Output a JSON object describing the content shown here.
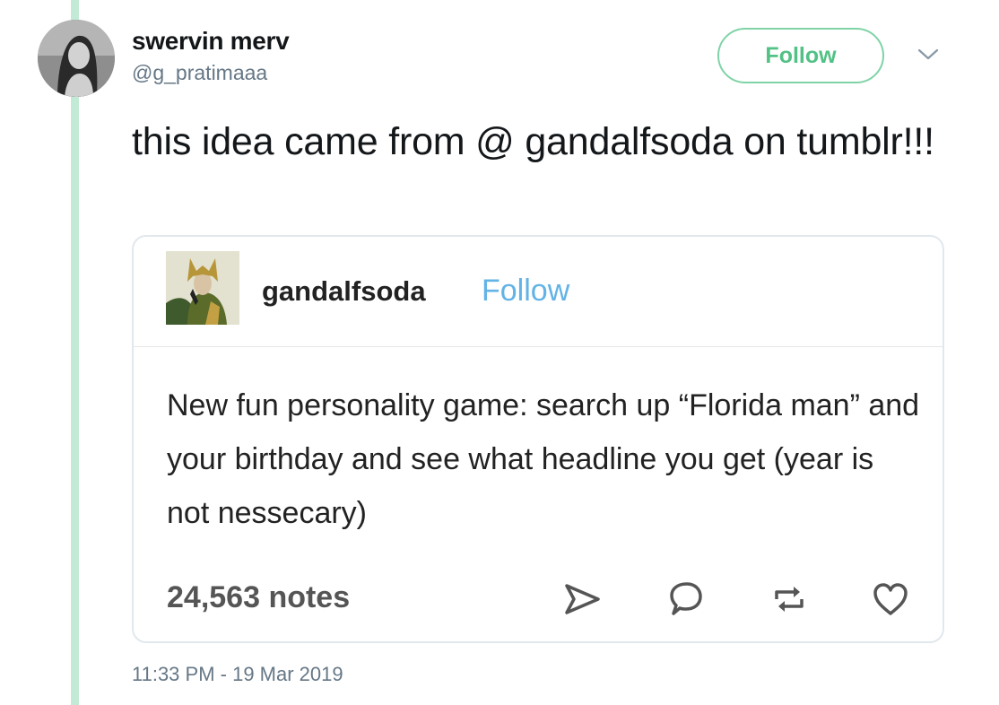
{
  "tweet": {
    "display_name": "swervin merv",
    "handle": "@g_pratimaaa",
    "follow_label": "Follow",
    "text": "this idea came from @ gandalfsoda on tumblr!!!",
    "timestamp": "11:33 PM - 19 Mar 2019"
  },
  "embed": {
    "username": "gandalfsoda",
    "follow_label": "Follow",
    "body": "New fun personality game: search up “Florida man” and your birthday and see what headline you get (year is not nessecary)",
    "notes": "24,563 notes",
    "actions": [
      "share-icon",
      "reply-icon",
      "reblog-icon",
      "like-icon"
    ]
  },
  "colors": {
    "thread_line": "#c3ead6",
    "follow_green": "#52c185",
    "tumblr_follow_blue": "#62b3e6",
    "secondary_text": "#657786"
  }
}
